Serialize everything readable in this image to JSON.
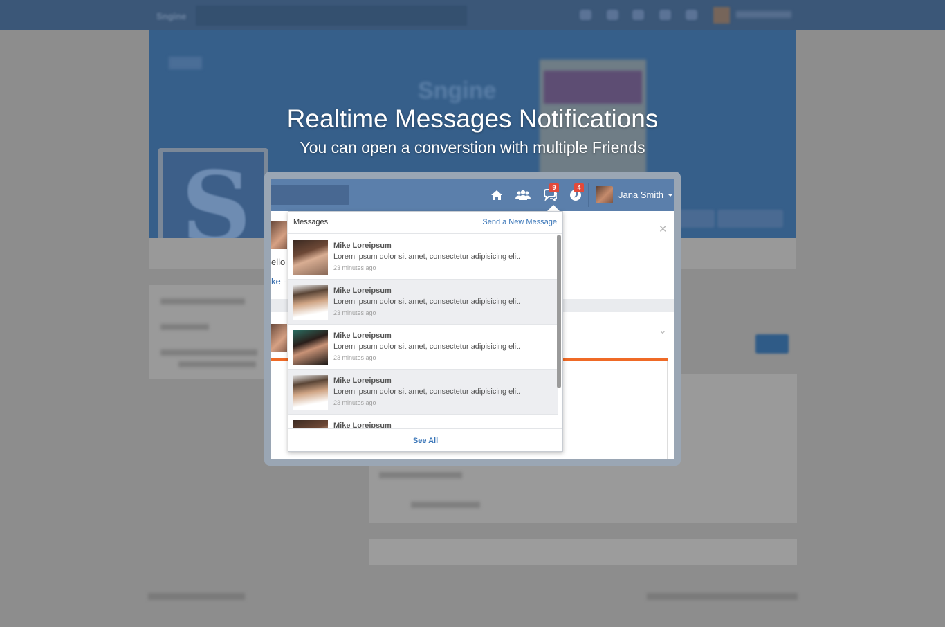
{
  "overlay": {
    "headline": "Realtime Messages Notifications",
    "subheadline": "You can open a converstion with multiple Friends"
  },
  "background": {
    "brand": "Sngine",
    "cover_title": "Sngine",
    "behind_text": "ello V",
    "behind_link": "ke - C"
  },
  "topbar": {
    "icons": [
      "home-icon",
      "friends-icon",
      "messages-icon",
      "notifications-icon"
    ],
    "messages_badge": "9",
    "notifications_badge": "4",
    "user_name": "Jana Smith"
  },
  "messages_dropdown": {
    "title": "Messages",
    "action": "Send a New Message",
    "items": [
      {
        "name": "Mike Loreipsum",
        "text": "Lorem ipsum dolor sit amet, consectetur adipisicing elit.",
        "time": "23 minutes ago",
        "highlighted": false
      },
      {
        "name": "Mike Loreipsum",
        "text": "Lorem ipsum dolor sit amet, consectetur adipisicing elit.",
        "time": "23 minutes ago",
        "highlighted": true
      },
      {
        "name": "Mike Loreipsum",
        "text": "Lorem ipsum dolor sit amet, consectetur adipisicing elit.",
        "time": "23 minutes ago",
        "highlighted": false
      },
      {
        "name": "Mike Loreipsum",
        "text": "Lorem ipsum dolor sit amet, consectetur adipisicing elit.",
        "time": "23 minutes ago",
        "highlighted": true
      },
      {
        "name": "Mike Loreipsum",
        "text": "",
        "time": "",
        "highlighted": false
      }
    ],
    "see_all": "See All"
  },
  "colors": {
    "topbar": "#5b7fab",
    "badge": "#e2493a",
    "link": "#3a76b8",
    "accent_line": "#ef6a26"
  }
}
